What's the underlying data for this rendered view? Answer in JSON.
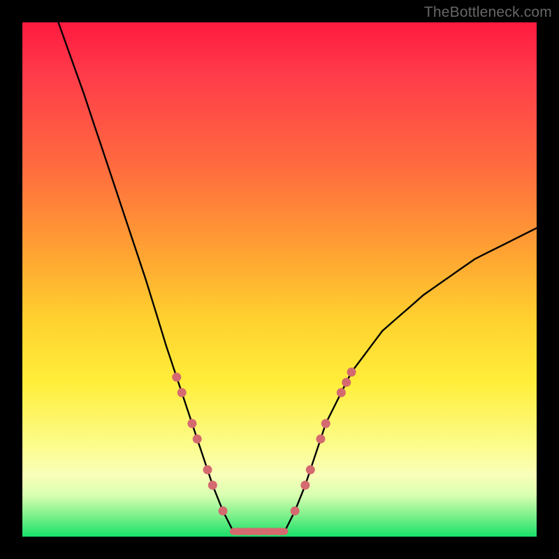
{
  "watermark": "TheBottleneck.com",
  "colors": {
    "page_bg": "#000000",
    "curve": "#000000",
    "marker_fill": "#d46a6f",
    "marker_stroke": "#c95a60",
    "flat_segment": "#d46a6f",
    "gradient_stops": [
      "#ff1a3f",
      "#ff3b4a",
      "#ff6b3f",
      "#ffa033",
      "#ffd22f",
      "#ffee3a",
      "#fcfc8a",
      "#f9ffb8",
      "#d8ffb0",
      "#7bf08a",
      "#18e06a"
    ]
  },
  "chart_data": {
    "type": "line",
    "title": "",
    "xlabel": "",
    "ylabel": "",
    "xlim": [
      0,
      100
    ],
    "ylim": [
      0,
      100
    ],
    "grid": false,
    "legend": false,
    "description": "Bottleneck curve: y (bottleneck %) vs x (component balance). Valley floor at ~0% between x≈41 and x≈51; curve rises sharply on both sides. Left branch starts near (7,100); right branch ends near (100,60).",
    "left_branch": [
      {
        "x": 7,
        "y": 100
      },
      {
        "x": 12,
        "y": 86
      },
      {
        "x": 18,
        "y": 68
      },
      {
        "x": 24,
        "y": 50
      },
      {
        "x": 28,
        "y": 37
      },
      {
        "x": 30,
        "y": 31
      },
      {
        "x": 31,
        "y": 28
      },
      {
        "x": 33,
        "y": 22
      },
      {
        "x": 34,
        "y": 19
      },
      {
        "x": 36,
        "y": 13
      },
      {
        "x": 37,
        "y": 10
      },
      {
        "x": 39,
        "y": 5
      },
      {
        "x": 41,
        "y": 1
      }
    ],
    "flat_segment": [
      {
        "x": 41,
        "y": 1
      },
      {
        "x": 51,
        "y": 1
      }
    ],
    "right_branch": [
      {
        "x": 51,
        "y": 1
      },
      {
        "x": 53,
        "y": 5
      },
      {
        "x": 55,
        "y": 10
      },
      {
        "x": 56,
        "y": 13
      },
      {
        "x": 58,
        "y": 19
      },
      {
        "x": 59,
        "y": 22
      },
      {
        "x": 62,
        "y": 28
      },
      {
        "x": 63,
        "y": 30
      },
      {
        "x": 64,
        "y": 32
      },
      {
        "x": 70,
        "y": 40
      },
      {
        "x": 78,
        "y": 47
      },
      {
        "x": 88,
        "y": 54
      },
      {
        "x": 100,
        "y": 60
      }
    ],
    "markers_left": [
      {
        "x": 30,
        "y": 31
      },
      {
        "x": 31,
        "y": 28
      },
      {
        "x": 33,
        "y": 22
      },
      {
        "x": 34,
        "y": 19
      },
      {
        "x": 36,
        "y": 13
      },
      {
        "x": 37,
        "y": 10
      },
      {
        "x": 39,
        "y": 5
      }
    ],
    "markers_right": [
      {
        "x": 53,
        "y": 5
      },
      {
        "x": 55,
        "y": 10
      },
      {
        "x": 56,
        "y": 13
      },
      {
        "x": 58,
        "y": 19
      },
      {
        "x": 59,
        "y": 22
      },
      {
        "x": 62,
        "y": 28
      },
      {
        "x": 63,
        "y": 30
      },
      {
        "x": 64,
        "y": 32
      }
    ],
    "valley_markers": [
      {
        "x": 42,
        "y": 1
      },
      {
        "x": 44,
        "y": 1
      },
      {
        "x": 46,
        "y": 1
      },
      {
        "x": 48,
        "y": 1
      },
      {
        "x": 50,
        "y": 1
      }
    ]
  }
}
